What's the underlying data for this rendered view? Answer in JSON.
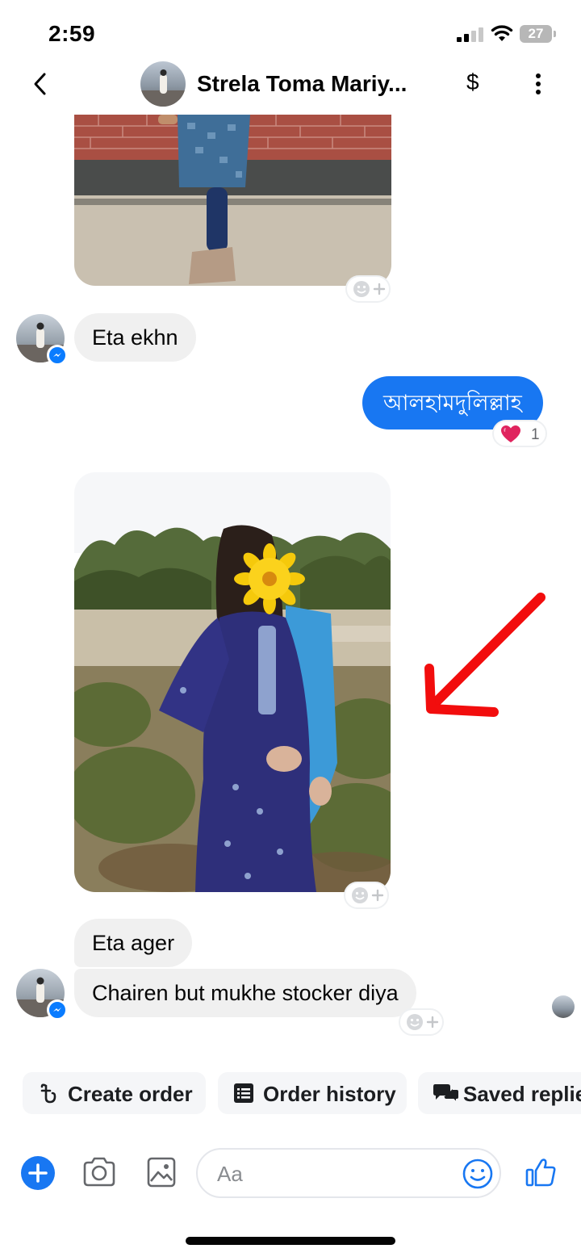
{
  "status_bar": {
    "time": "2:59",
    "battery": "27"
  },
  "header": {
    "title": "Strela Toma Mariy...",
    "currency_symbol": "$"
  },
  "messages": [
    {
      "type": "photo",
      "direction": "incoming"
    },
    {
      "type": "text",
      "direction": "incoming",
      "text": "Eta ekhn"
    },
    {
      "type": "text",
      "direction": "outgoing",
      "text": "আলহামদুলিল্লাহ",
      "reaction": {
        "emoji": "heart",
        "count": "1"
      }
    },
    {
      "type": "photo",
      "direction": "incoming"
    },
    {
      "type": "text",
      "direction": "incoming",
      "text": "Eta ager"
    },
    {
      "type": "text",
      "direction": "incoming",
      "text": "Chairen but mukhe stocker diya"
    }
  ],
  "quick_actions": [
    {
      "label": "Create order",
      "icon": "taka-icon"
    },
    {
      "label": "Order history",
      "icon": "list-icon"
    },
    {
      "label": "Saved replies",
      "icon": "chat-bubbles-icon"
    }
  ],
  "composer": {
    "placeholder": "Aa"
  },
  "colors": {
    "accent": "#1877f2",
    "incoming_bubble": "#f0f0f0",
    "annotation_arrow": "#f20d0d",
    "heart": "#e0245e"
  }
}
